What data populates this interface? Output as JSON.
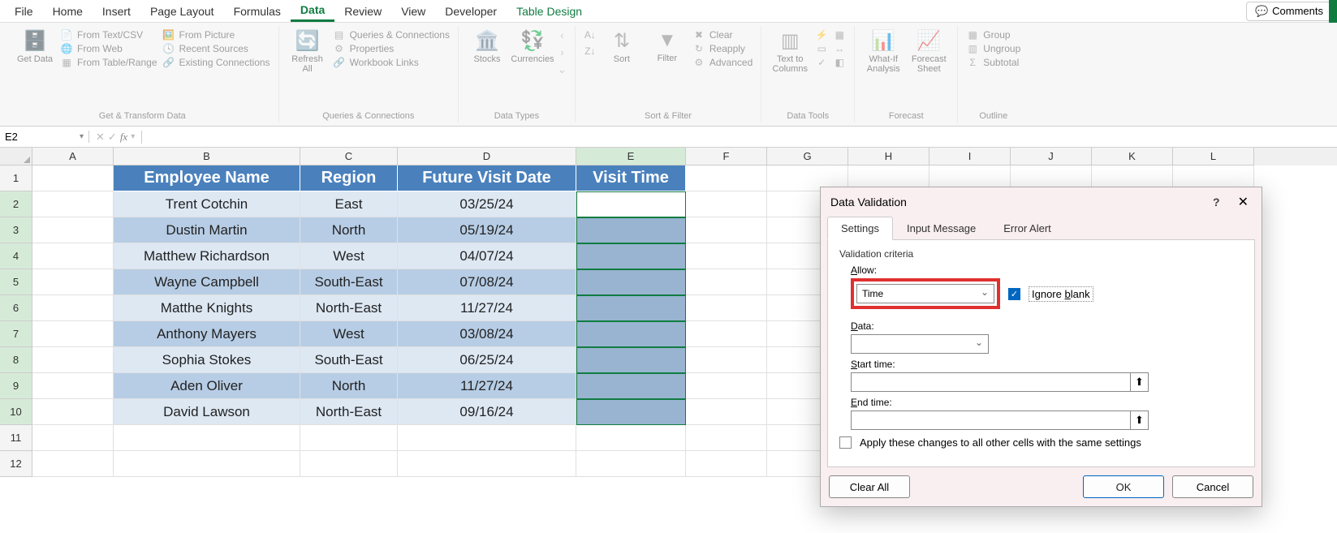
{
  "menu": {
    "tabs": [
      "File",
      "Home",
      "Insert",
      "Page Layout",
      "Formulas",
      "Data",
      "Review",
      "View",
      "Developer",
      "Table Design"
    ],
    "active": "Data",
    "contextual": "Table Design",
    "comments": "Comments"
  },
  "ribbon": {
    "groups": [
      {
        "label": "Get & Transform Data",
        "big": [
          {
            "name": "get-data",
            "label": "Get Data"
          }
        ],
        "items": [
          "From Text/CSV",
          "From Web",
          "From Table/Range",
          "From Picture",
          "Recent Sources",
          "Existing Connections"
        ]
      },
      {
        "label": "Queries & Connections",
        "big": [
          {
            "name": "refresh-all",
            "label": "Refresh All"
          }
        ],
        "items": [
          "Queries & Connections",
          "Properties",
          "Workbook Links"
        ]
      },
      {
        "label": "Data Types",
        "big": [
          {
            "name": "stocks",
            "label": "Stocks"
          },
          {
            "name": "currencies",
            "label": "Currencies"
          }
        ],
        "items": []
      },
      {
        "label": "Sort & Filter",
        "big": [
          {
            "name": "sort",
            "label": "Sort"
          },
          {
            "name": "filter",
            "label": "Filter"
          }
        ],
        "items": [
          "Clear",
          "Reapply",
          "Advanced"
        ]
      },
      {
        "label": "Data Tools",
        "big": [
          {
            "name": "text-to-columns",
            "label": "Text to Columns"
          }
        ],
        "items": []
      },
      {
        "label": "Forecast",
        "big": [
          {
            "name": "what-if",
            "label": "What-If Analysis"
          },
          {
            "name": "forecast-sheet",
            "label": "Forecast Sheet"
          }
        ],
        "items": []
      },
      {
        "label": "Outline",
        "big": [],
        "items": [
          "Group",
          "Ungroup",
          "Subtotal"
        ]
      }
    ]
  },
  "namebox": "E2",
  "columns": [
    "A",
    "B",
    "C",
    "D",
    "E",
    "F",
    "G",
    "H",
    "I",
    "J",
    "K",
    "L"
  ],
  "col_widths": {
    "A": 100,
    "B": 230,
    "C": 120,
    "D": 220,
    "E": 135,
    "F": 100,
    "G": 100,
    "H": 100,
    "I": 100,
    "J": 100,
    "K": 100,
    "L": 100
  },
  "selected_col": "E",
  "row_count": 12,
  "selected_rows": [
    2,
    3,
    4,
    5,
    6,
    7,
    8,
    9,
    10
  ],
  "table": {
    "headers": [
      "Employee Name",
      "Region",
      "Future Visit Date",
      "Visit Time"
    ],
    "rows": [
      [
        "Trent Cotchin",
        "East",
        "03/25/24",
        ""
      ],
      [
        "Dustin Martin",
        "North",
        "05/19/24",
        ""
      ],
      [
        "Matthew Richardson",
        "West",
        "04/07/24",
        ""
      ],
      [
        "Wayne Campbell",
        "South-East",
        "07/08/24",
        ""
      ],
      [
        "Matthe Knights",
        "North-East",
        "11/27/24",
        ""
      ],
      [
        "Anthony Mayers",
        "West",
        "03/08/24",
        ""
      ],
      [
        "Sophia Stokes",
        "South-East",
        "06/25/24",
        ""
      ],
      [
        "Aden Oliver",
        "North",
        "11/27/24",
        ""
      ],
      [
        "David Lawson",
        "North-East",
        "09/16/24",
        ""
      ]
    ]
  },
  "dialog": {
    "title": "Data Validation",
    "tabs": [
      "Settings",
      "Input Message",
      "Error Alert"
    ],
    "active_tab": "Settings",
    "section": "Validation criteria",
    "allow_label": "Allow:",
    "allow_value": "Time",
    "ignore_blank": "Ignore blank",
    "data_label": "Data:",
    "data_value": "",
    "start_label": "Start time:",
    "end_label": "End time:",
    "apply_label": "Apply these changes to all other cells with the same settings",
    "clear": "Clear All",
    "ok": "OK",
    "cancel": "Cancel"
  }
}
